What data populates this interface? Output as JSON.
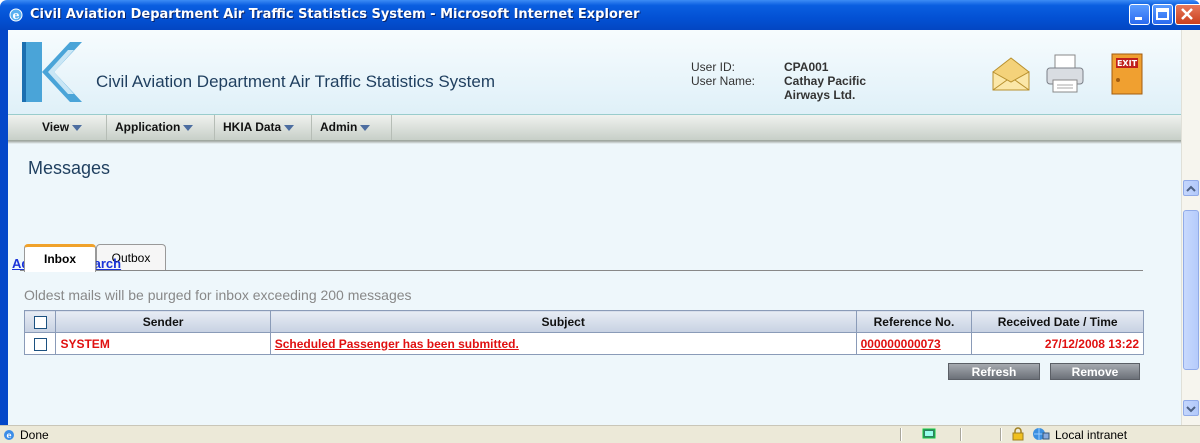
{
  "window": {
    "title": "Civil Aviation Department Air Traffic Statistics System - Microsoft Internet Explorer"
  },
  "header": {
    "app_title": "Civil Aviation Department Air Traffic Statistics System",
    "user_id_label": "User ID:",
    "user_id": "CPA001",
    "user_name_label": "User Name:",
    "user_name_line1": "Cathay Pacific",
    "user_name_line2": "Airways Ltd.",
    "icons": [
      "envelope-icon",
      "printer-icon",
      "exit-door-icon"
    ],
    "exit_sign": "EXIT"
  },
  "menu": [
    {
      "label": "View"
    },
    {
      "label": "Application"
    },
    {
      "label": "HKIA Data"
    },
    {
      "label": "Admin"
    }
  ],
  "page": {
    "title": "Messages",
    "tabs": [
      {
        "label": "Inbox",
        "active": true
      },
      {
        "label": "Outbox",
        "active": false
      }
    ],
    "advanced_search": "Advanced Search",
    "purge_note": "Oldest mails will be purged for inbox exceeding 200 messages"
  },
  "table": {
    "columns": [
      "Sender",
      "Subject",
      "Reference No.",
      "Received Date / Time"
    ],
    "rows": [
      {
        "sender": "SYSTEM",
        "subject": "Scheduled Passenger has been submitted.",
        "reference": "000000000073",
        "received": "27/12/2008 13:22"
      }
    ]
  },
  "buttons": {
    "refresh": "Refresh",
    "remove": "Remove"
  },
  "status": {
    "text": "Done",
    "zone": "Local intranet"
  },
  "colors": {
    "link_red": "#e01010",
    "link_blue": "#1a33d8",
    "tab_accent": "#f0a22b"
  }
}
